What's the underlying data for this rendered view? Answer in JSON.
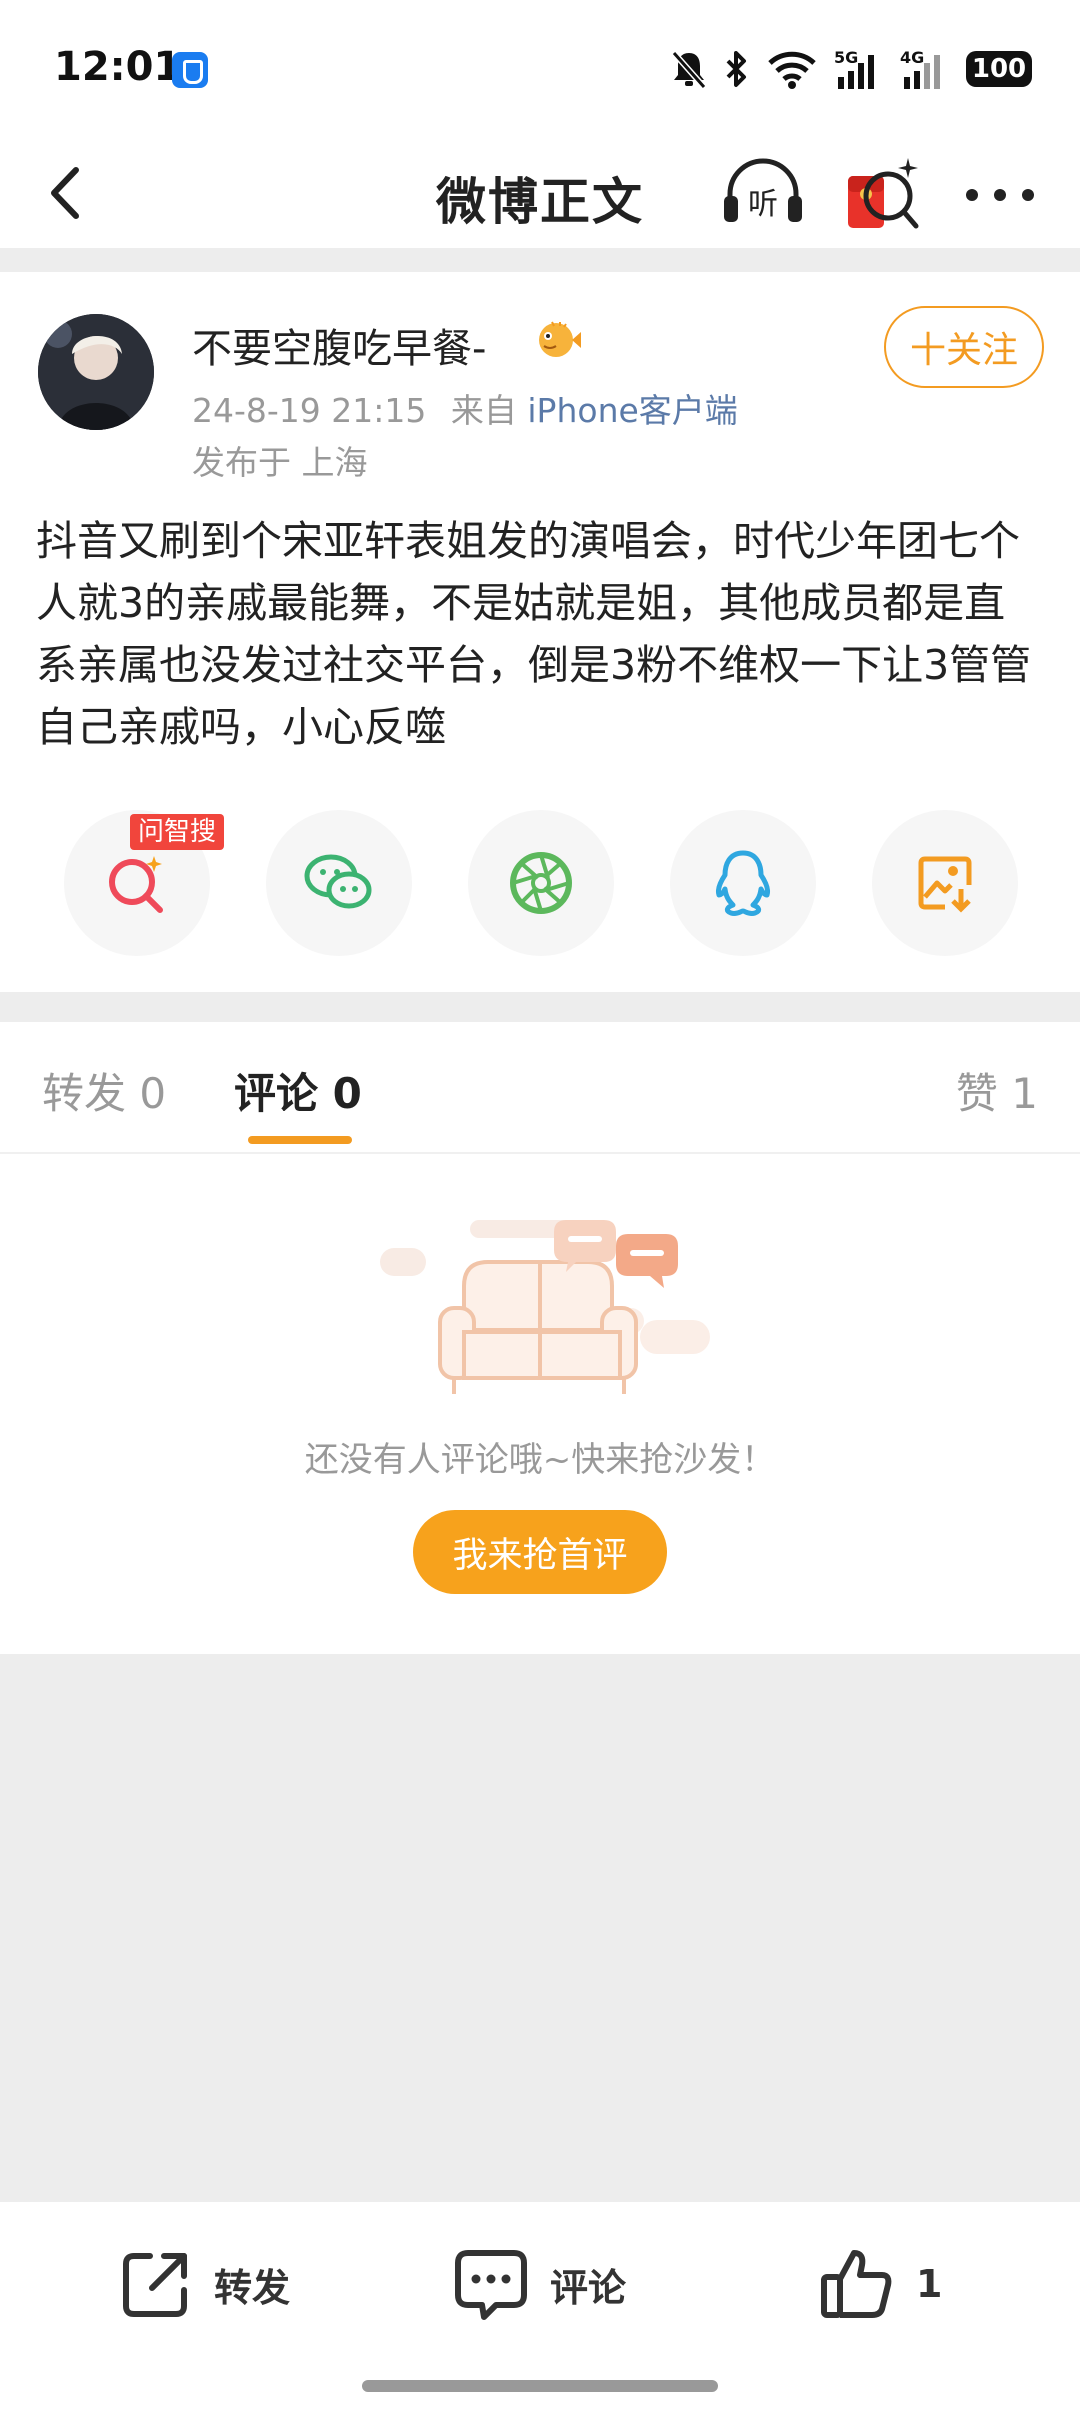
{
  "status": {
    "time": "12:01",
    "battery": "100"
  },
  "nav": {
    "title": "微博正文"
  },
  "post": {
    "author": "不要空腹吃早餐-",
    "date": "24-8-19 21:15",
    "source_prefix": "来自",
    "source": "iPhone客户端",
    "location": "发布于 上海",
    "follow_label": "十关注",
    "text": "抖音又刷到个宋亚轩表姐发的演唱会，时代少年团七个人就3的亲戚最能舞，不是姑就是姐，其他成员都是直系亲属也没发过社交平台，倒是3粉不维权一下让3管管自己亲戚吗，小心反噬",
    "search_tag": "问智搜"
  },
  "tabs": {
    "repost": "转发 0",
    "comment": "评论 0",
    "like": "赞 1"
  },
  "empty": {
    "message": "还没有人评论哦~快来抢沙发！",
    "button": "我来抢首评"
  },
  "bottom": {
    "repost": "转发",
    "comment": "评论",
    "like_count": "1"
  },
  "colors": {
    "accent": "#f39b21",
    "link": "#5b7aa8",
    "tag": "#f1453c"
  }
}
